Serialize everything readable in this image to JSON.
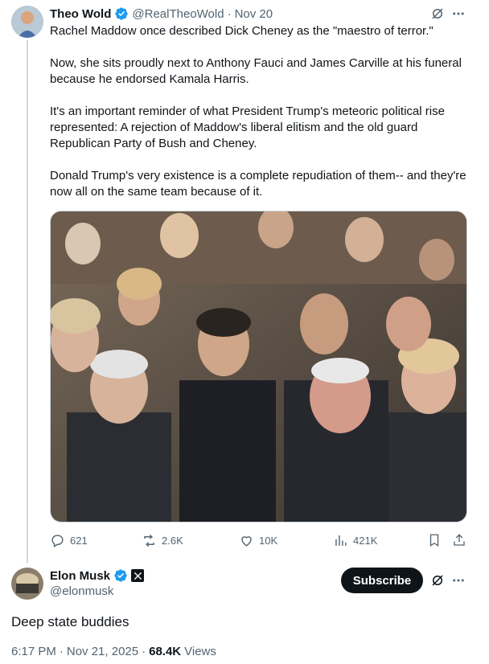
{
  "quoted_tweet": {
    "author_name": "Theo Wold",
    "author_handle": "@RealTheoWold",
    "separator": "·",
    "date": "Nov 20",
    "text": "Rachel Maddow once described Dick Cheney as the \"maestro of terror.\"\n\nNow, she sits proudly next to Anthony Fauci and James Carville at his funeral because he endorsed Kamala Harris.\n\nIt's an important reminder of what President Trump's meteoric political rise represented: A rejection of Maddow's liberal elitism and the old guard Republican Party of Bush and Cheney.\n\nDonald Trump's very existence is a complete repudiation of them-- and they're now all on the same team because of it.",
    "stats": {
      "replies": "621",
      "reposts": "2.6K",
      "likes": "10K",
      "views": "421K"
    }
  },
  "main_tweet": {
    "author_name": "Elon Musk",
    "author_handle": "@elonmusk",
    "subscribe_label": "Subscribe",
    "text": "Deep state buddies",
    "time": "6:17 PM",
    "separator": "·",
    "date": "Nov 21, 2025",
    "views_count": "68.4K",
    "views_label": "Views"
  },
  "colors": {
    "verified": "#1d9bf0",
    "text_primary": "#0f1419",
    "text_secondary": "#536471",
    "thread_line": "#cfd9de"
  },
  "icons": [
    "grok-icon",
    "more-icon",
    "reply-icon",
    "repost-icon",
    "like-icon",
    "views-icon",
    "bookmark-icon",
    "share-icon",
    "verified-badge-icon",
    "x-affiliate-icon"
  ]
}
